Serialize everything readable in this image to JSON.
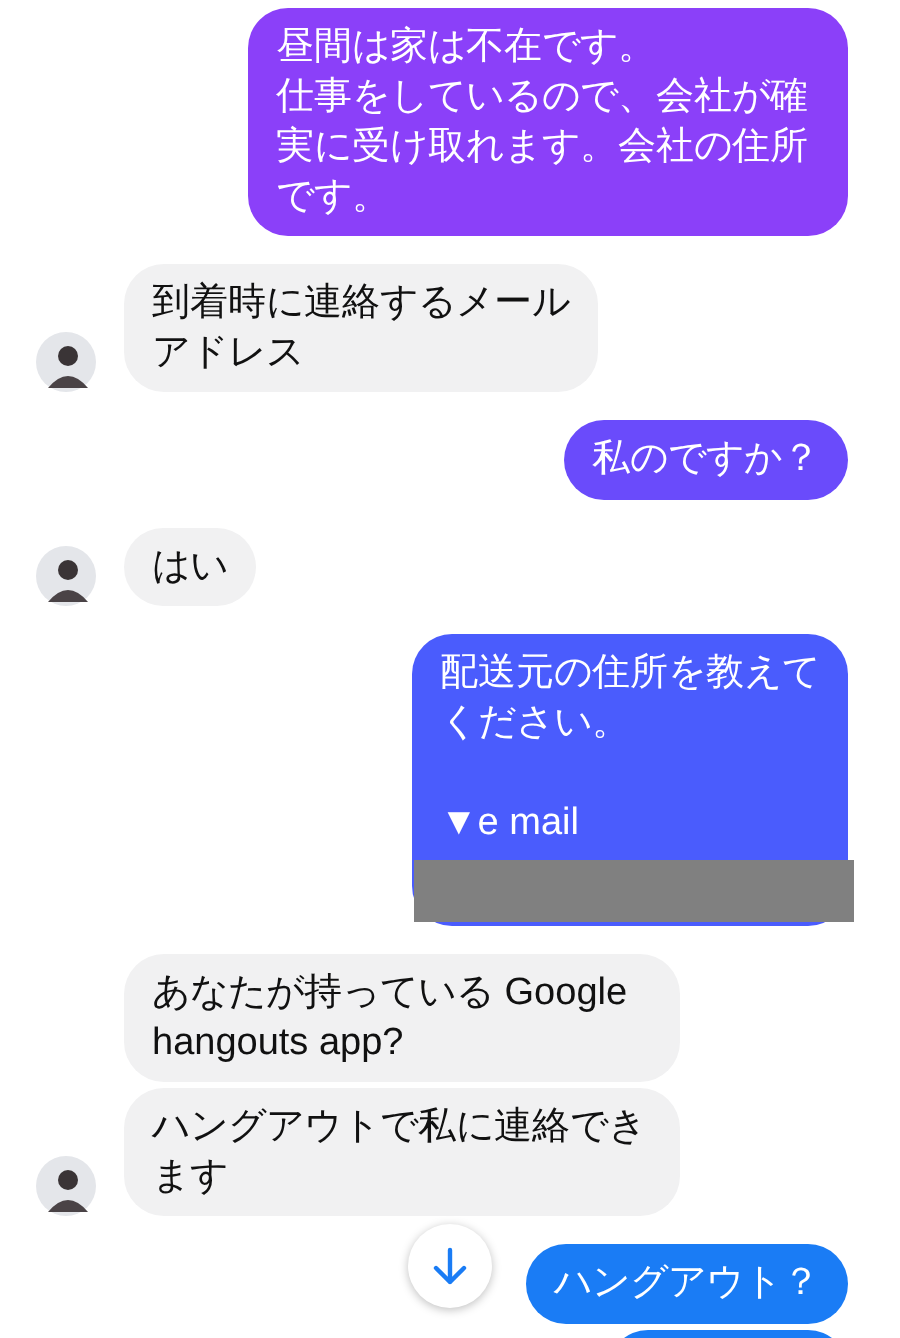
{
  "messages": [
    {
      "kind": "outgoing",
      "lines": [
        "昼間は家は不在です。",
        "仕事をしているので、会社が確実に受け取れます。会社の住所です。"
      ],
      "color": "#8b40f9"
    },
    {
      "kind": "incoming",
      "lines": [
        "到着時に連絡するメール",
        "アドレス"
      ],
      "show_avatar": true
    },
    {
      "kind": "outgoing",
      "lines": [
        "私のですか？"
      ],
      "color": "#6a4bfb"
    },
    {
      "kind": "incoming",
      "lines": [
        "はい"
      ],
      "show_avatar": true
    },
    {
      "kind": "outgoing",
      "lines": [
        "配送元の住所を教えて",
        "ください。"
      ],
      "note": "▼e mail",
      "color": "#4a5cfd",
      "redacted": true
    },
    {
      "kind": "incoming",
      "lines": [
        "あなたが持っている Google hangouts app?"
      ],
      "show_avatar": false
    },
    {
      "kind": "incoming",
      "lines": [
        "ハングアウトで私に連絡できます"
      ],
      "show_avatar": true
    },
    {
      "kind": "outgoing",
      "lines": [
        "ハングアウト？"
      ],
      "color": "#1a7cf5"
    },
    {
      "kind": "outgoing",
      "color": "#1a7cf5"
    }
  ]
}
